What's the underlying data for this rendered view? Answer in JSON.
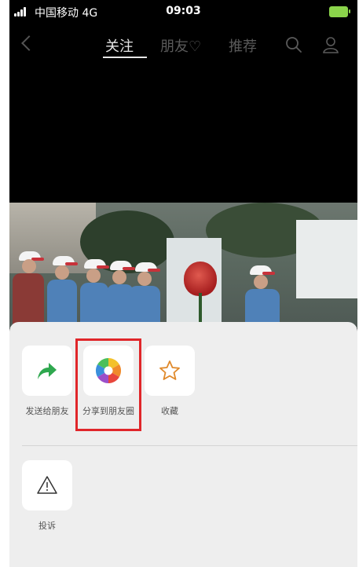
{
  "status_bar": {
    "carrier": "中国移动",
    "network": "4G",
    "time": "09:03"
  },
  "nav": {
    "tabs": [
      {
        "label": "关注",
        "active": true
      },
      {
        "label": "朋友♡",
        "active": false
      },
      {
        "label": "推荐",
        "active": false
      }
    ]
  },
  "share_sheet": {
    "actions": [
      {
        "label": "发送给朋友",
        "icon": "forward-arrow-icon"
      },
      {
        "label": "分享到朋友圈",
        "icon": "moments-shutter-icon",
        "highlighted": true
      },
      {
        "label": "收藏",
        "icon": "star-icon"
      }
    ],
    "secondary_actions": [
      {
        "label": "投诉",
        "icon": "warning-triangle-icon"
      }
    ]
  },
  "colors": {
    "forward_green": "#2fa84f",
    "star_orange": "#e08a2c",
    "highlight_red": "#e0262a"
  }
}
